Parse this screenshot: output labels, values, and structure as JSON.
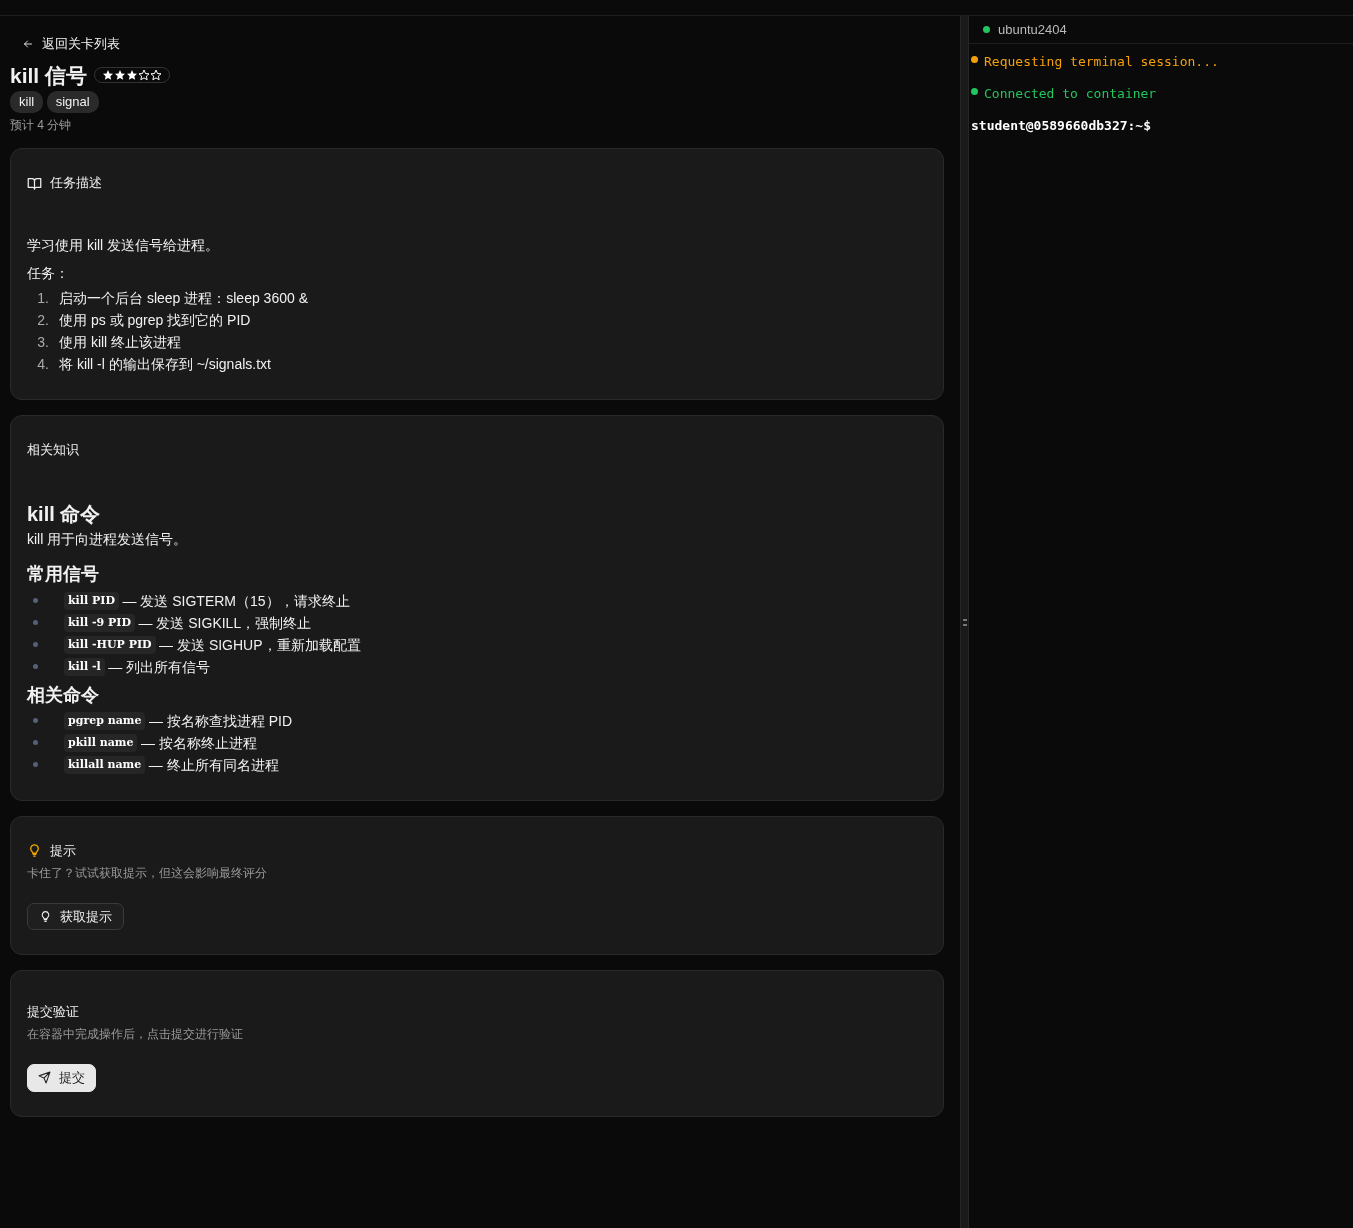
{
  "back_link": "返回关卡列表",
  "title": "kill 信号",
  "difficulty": {
    "stars": 3
  },
  "tags": [
    "kill",
    "signal"
  ],
  "estimate": "预计 4 分钟",
  "task_card": {
    "title": "任务描述",
    "intro": "学习使用 kill 发送信号给进程。",
    "label": "任务：",
    "steps": [
      {
        "number": "1.",
        "text": "启动一个后台 sleep 进程：sleep 3600 &"
      },
      {
        "number": "2.",
        "text": "使用 ps 或 pgrep 找到它的 PID"
      },
      {
        "number": "3.",
        "text": "使用 kill 终止该进程"
      },
      {
        "number": "4.",
        "text": "将 kill -l 的输出保存到 ~/signals.txt"
      }
    ]
  },
  "knowledge_card": {
    "title": "相关知识",
    "heading": "kill 命令",
    "intro": "kill 用于向进程发送信号。",
    "sections": [
      {
        "heading": "常用信号",
        "items": [
          {
            "code": "kill PID",
            "text": "— 发送 SIGTERM（15），请求终止"
          },
          {
            "code": "kill -9 PID",
            "text": "— 发送 SIGKILL，强制终止"
          },
          {
            "code": "kill -HUP PID",
            "text": "— 发送 SIGHUP，重新加载配置"
          },
          {
            "code": "kill -l",
            "text": "— 列出所有信号"
          }
        ]
      },
      {
        "heading": "相关命令",
        "items": [
          {
            "code": "pgrep name",
            "text": "— 按名称查找进程 PID"
          },
          {
            "code": "pkill name",
            "text": "— 按名称终止进程"
          },
          {
            "code": "killall name",
            "text": "— 终止所有同名进程"
          }
        ]
      }
    ]
  },
  "hint_card": {
    "title": "提示",
    "subtitle": "卡住了？试试获取提示，但这会影响最终评分",
    "button": "获取提示"
  },
  "submit_card": {
    "title": "提交验证",
    "subtitle": "在容器中完成操作后，点击提交进行验证",
    "button": "提交"
  },
  "terminal": {
    "tab": {
      "label": "ubuntu2404",
      "color": "#22c55e"
    },
    "lines": [
      {
        "kind": "status",
        "text": "Requesting terminal session...",
        "color": "#f5a00b"
      },
      {
        "kind": "status",
        "text": "Connected to container",
        "color": "#22c55e"
      },
      {
        "kind": "prompt",
        "text": "student@0589660db327:~$"
      }
    ]
  }
}
